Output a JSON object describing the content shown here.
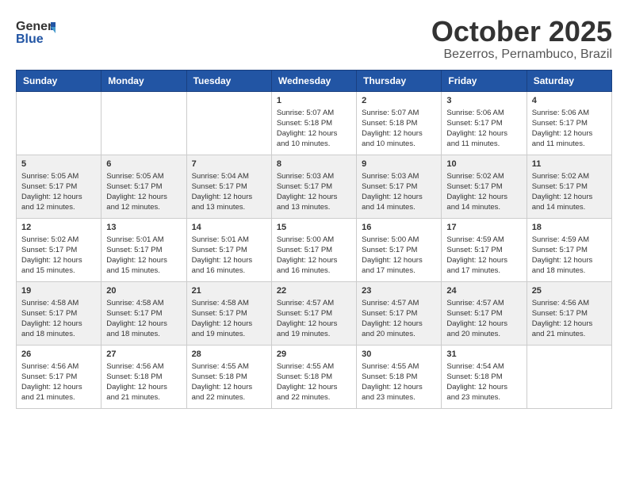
{
  "header": {
    "logo_general": "General",
    "logo_blue": "Blue",
    "month": "October 2025",
    "location": "Bezerros, Pernambuco, Brazil"
  },
  "weekdays": [
    "Sunday",
    "Monday",
    "Tuesday",
    "Wednesday",
    "Thursday",
    "Friday",
    "Saturday"
  ],
  "weeks": [
    [
      {
        "day": "",
        "detail": ""
      },
      {
        "day": "",
        "detail": ""
      },
      {
        "day": "",
        "detail": ""
      },
      {
        "day": "1",
        "detail": "Sunrise: 5:07 AM\nSunset: 5:18 PM\nDaylight: 12 hours\nand 10 minutes."
      },
      {
        "day": "2",
        "detail": "Sunrise: 5:07 AM\nSunset: 5:18 PM\nDaylight: 12 hours\nand 10 minutes."
      },
      {
        "day": "3",
        "detail": "Sunrise: 5:06 AM\nSunset: 5:17 PM\nDaylight: 12 hours\nand 11 minutes."
      },
      {
        "day": "4",
        "detail": "Sunrise: 5:06 AM\nSunset: 5:17 PM\nDaylight: 12 hours\nand 11 minutes."
      }
    ],
    [
      {
        "day": "5",
        "detail": "Sunrise: 5:05 AM\nSunset: 5:17 PM\nDaylight: 12 hours\nand 12 minutes."
      },
      {
        "day": "6",
        "detail": "Sunrise: 5:05 AM\nSunset: 5:17 PM\nDaylight: 12 hours\nand 12 minutes."
      },
      {
        "day": "7",
        "detail": "Sunrise: 5:04 AM\nSunset: 5:17 PM\nDaylight: 12 hours\nand 13 minutes."
      },
      {
        "day": "8",
        "detail": "Sunrise: 5:03 AM\nSunset: 5:17 PM\nDaylight: 12 hours\nand 13 minutes."
      },
      {
        "day": "9",
        "detail": "Sunrise: 5:03 AM\nSunset: 5:17 PM\nDaylight: 12 hours\nand 14 minutes."
      },
      {
        "day": "10",
        "detail": "Sunrise: 5:02 AM\nSunset: 5:17 PM\nDaylight: 12 hours\nand 14 minutes."
      },
      {
        "day": "11",
        "detail": "Sunrise: 5:02 AM\nSunset: 5:17 PM\nDaylight: 12 hours\nand 14 minutes."
      }
    ],
    [
      {
        "day": "12",
        "detail": "Sunrise: 5:02 AM\nSunset: 5:17 PM\nDaylight: 12 hours\nand 15 minutes."
      },
      {
        "day": "13",
        "detail": "Sunrise: 5:01 AM\nSunset: 5:17 PM\nDaylight: 12 hours\nand 15 minutes."
      },
      {
        "day": "14",
        "detail": "Sunrise: 5:01 AM\nSunset: 5:17 PM\nDaylight: 12 hours\nand 16 minutes."
      },
      {
        "day": "15",
        "detail": "Sunrise: 5:00 AM\nSunset: 5:17 PM\nDaylight: 12 hours\nand 16 minutes."
      },
      {
        "day": "16",
        "detail": "Sunrise: 5:00 AM\nSunset: 5:17 PM\nDaylight: 12 hours\nand 17 minutes."
      },
      {
        "day": "17",
        "detail": "Sunrise: 4:59 AM\nSunset: 5:17 PM\nDaylight: 12 hours\nand 17 minutes."
      },
      {
        "day": "18",
        "detail": "Sunrise: 4:59 AM\nSunset: 5:17 PM\nDaylight: 12 hours\nand 18 minutes."
      }
    ],
    [
      {
        "day": "19",
        "detail": "Sunrise: 4:58 AM\nSunset: 5:17 PM\nDaylight: 12 hours\nand 18 minutes."
      },
      {
        "day": "20",
        "detail": "Sunrise: 4:58 AM\nSunset: 5:17 PM\nDaylight: 12 hours\nand 18 minutes."
      },
      {
        "day": "21",
        "detail": "Sunrise: 4:58 AM\nSunset: 5:17 PM\nDaylight: 12 hours\nand 19 minutes."
      },
      {
        "day": "22",
        "detail": "Sunrise: 4:57 AM\nSunset: 5:17 PM\nDaylight: 12 hours\nand 19 minutes."
      },
      {
        "day": "23",
        "detail": "Sunrise: 4:57 AM\nSunset: 5:17 PM\nDaylight: 12 hours\nand 20 minutes."
      },
      {
        "day": "24",
        "detail": "Sunrise: 4:57 AM\nSunset: 5:17 PM\nDaylight: 12 hours\nand 20 minutes."
      },
      {
        "day": "25",
        "detail": "Sunrise: 4:56 AM\nSunset: 5:17 PM\nDaylight: 12 hours\nand 21 minutes."
      }
    ],
    [
      {
        "day": "26",
        "detail": "Sunrise: 4:56 AM\nSunset: 5:17 PM\nDaylight: 12 hours\nand 21 minutes."
      },
      {
        "day": "27",
        "detail": "Sunrise: 4:56 AM\nSunset: 5:18 PM\nDaylight: 12 hours\nand 21 minutes."
      },
      {
        "day": "28",
        "detail": "Sunrise: 4:55 AM\nSunset: 5:18 PM\nDaylight: 12 hours\nand 22 minutes."
      },
      {
        "day": "29",
        "detail": "Sunrise: 4:55 AM\nSunset: 5:18 PM\nDaylight: 12 hours\nand 22 minutes."
      },
      {
        "day": "30",
        "detail": "Sunrise: 4:55 AM\nSunset: 5:18 PM\nDaylight: 12 hours\nand 23 minutes."
      },
      {
        "day": "31",
        "detail": "Sunrise: 4:54 AM\nSunset: 5:18 PM\nDaylight: 12 hours\nand 23 minutes."
      },
      {
        "day": "",
        "detail": ""
      }
    ]
  ]
}
